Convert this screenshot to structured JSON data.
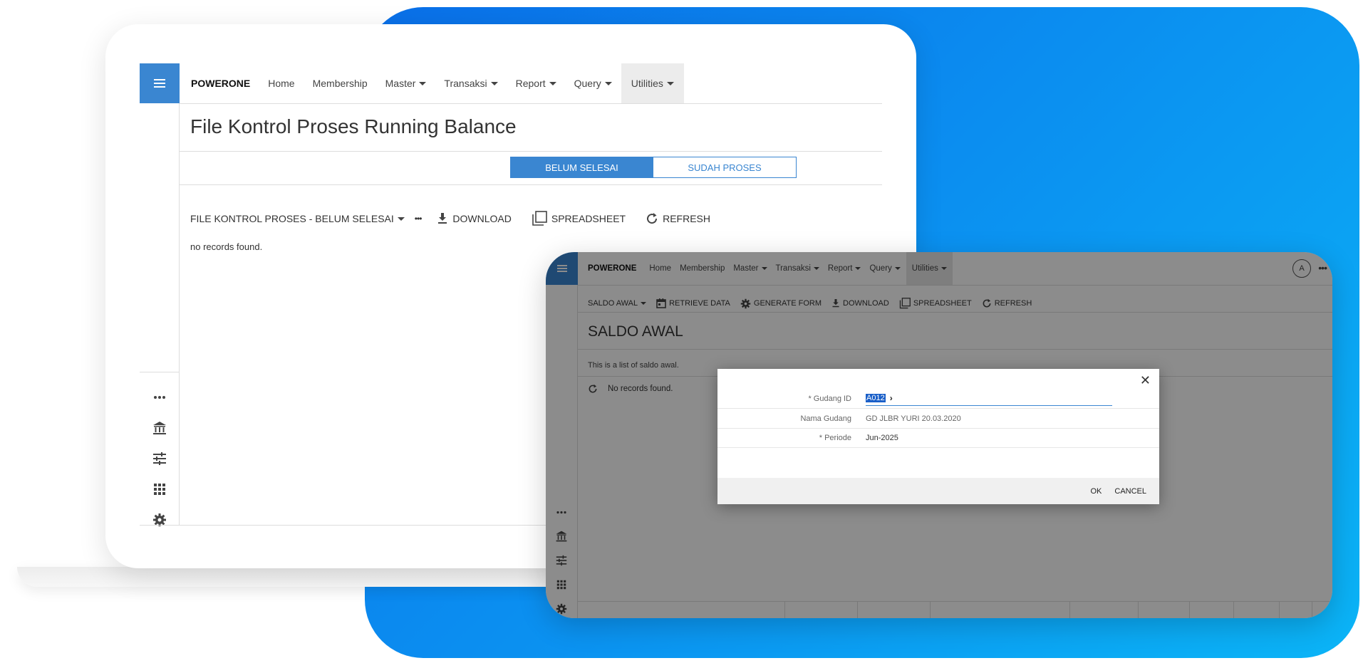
{
  "colors": {
    "accent": "#3a86d1",
    "background_gradient_start": "#0a6fe8",
    "background_gradient_end": "#0bb4f6"
  },
  "screen1": {
    "brand": "POWERONE",
    "nav": [
      {
        "label": "Home",
        "dropdown": false
      },
      {
        "label": "Membership",
        "dropdown": false
      },
      {
        "label": "Master",
        "dropdown": true
      },
      {
        "label": "Transaksi",
        "dropdown": true
      },
      {
        "label": "Report",
        "dropdown": true
      },
      {
        "label": "Query",
        "dropdown": true
      },
      {
        "label": "Utilities",
        "dropdown": true,
        "active": true
      }
    ],
    "page_title": "File Kontrol Proses Running Balance",
    "segments": {
      "belum": "BELUM SELESAI",
      "sudah": "SUDAH PROSES",
      "selected": "BELUM SELESAI"
    },
    "toolbar": {
      "view_label": "FILE KONTROL PROSES - BELUM SELESAI",
      "more": "•••",
      "download": "DOWNLOAD",
      "spreadsheet": "SPREADSHEET",
      "refresh": "REFRESH"
    },
    "no_records": "no records found.",
    "sidebar_icons": [
      "more-icon",
      "bank-icon",
      "sliders-icon",
      "grid-icon",
      "gear-icon"
    ]
  },
  "screen2": {
    "brand": "POWERONE",
    "nav": [
      {
        "label": "Home",
        "dropdown": false
      },
      {
        "label": "Membership",
        "dropdown": false
      },
      {
        "label": "Master",
        "dropdown": true
      },
      {
        "label": "Transaksi",
        "dropdown": true
      },
      {
        "label": "Report",
        "dropdown": true
      },
      {
        "label": "Query",
        "dropdown": true
      },
      {
        "label": "Utilities",
        "dropdown": true,
        "active": true
      }
    ],
    "avatar": "A",
    "more": "•••",
    "toolbar": {
      "saldo_awal": "SALDO AWAL",
      "retrieve": "RETRIEVE DATA",
      "generate": "GENERATE FORM",
      "download": "DOWNLOAD",
      "spreadsheet": "SPREADSHEET",
      "refresh": "REFRESH"
    },
    "page_title": "SALDO AWAL",
    "description": "This is a list of saldo awal.",
    "no_records": "No records found.",
    "sidebar_icons": [
      "more-icon",
      "bank-icon",
      "sliders-icon",
      "grid-icon",
      "gear-icon"
    ],
    "dialog": {
      "gudang_id_label": "* Gudang ID",
      "gudang_id_value": "A012",
      "nama_gudang_label": "Nama Gudang",
      "nama_gudang_value": "GD JLBR YURI 20.03.2020",
      "periode_label": "* Periode",
      "periode_value": "Jun-2025",
      "ok": "OK",
      "cancel": "CANCEL"
    }
  }
}
